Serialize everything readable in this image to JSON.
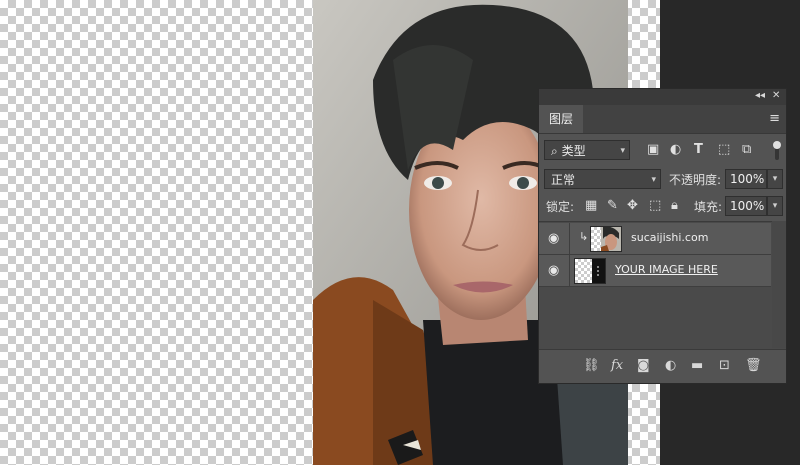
{
  "panel": {
    "collapse_icon": "double-chevron-left-icon",
    "close_icon": "close-icon",
    "tab_label": "图层",
    "menu_icon": "hamburger-menu-icon"
  },
  "filter": {
    "kind_label": "类型",
    "icons": [
      "image-filter-icon",
      "adjustment-filter-icon",
      "type-filter-icon",
      "shape-filter-icon",
      "smart-object-filter-icon"
    ]
  },
  "blend": {
    "mode": "正常",
    "opacity_label": "不透明度:",
    "opacity_value": "100%"
  },
  "lock": {
    "label": "锁定:",
    "icons": [
      "lock-transparent-pixels-icon",
      "lock-image-pixels-icon",
      "lock-position-icon",
      "lock-artboard-icon",
      "lock-all-icon"
    ],
    "fill_label": "填充:",
    "fill_value": "100%"
  },
  "layers": [
    {
      "name": "sucaijishi.com",
      "visible": true,
      "clipped": true,
      "underlined": false
    },
    {
      "name": "YOUR IMAGE HERE ",
      "visible": true,
      "clipped": false,
      "underlined": true
    }
  ],
  "bottom_icons": [
    "link-layers-icon",
    "fx-icon",
    "add-mask-icon",
    "adjustment-layer-icon",
    "new-group-icon",
    "new-layer-icon",
    "trash-icon"
  ],
  "colors": {
    "panel_bg": "#535353",
    "workspace_bg": "#282828"
  }
}
